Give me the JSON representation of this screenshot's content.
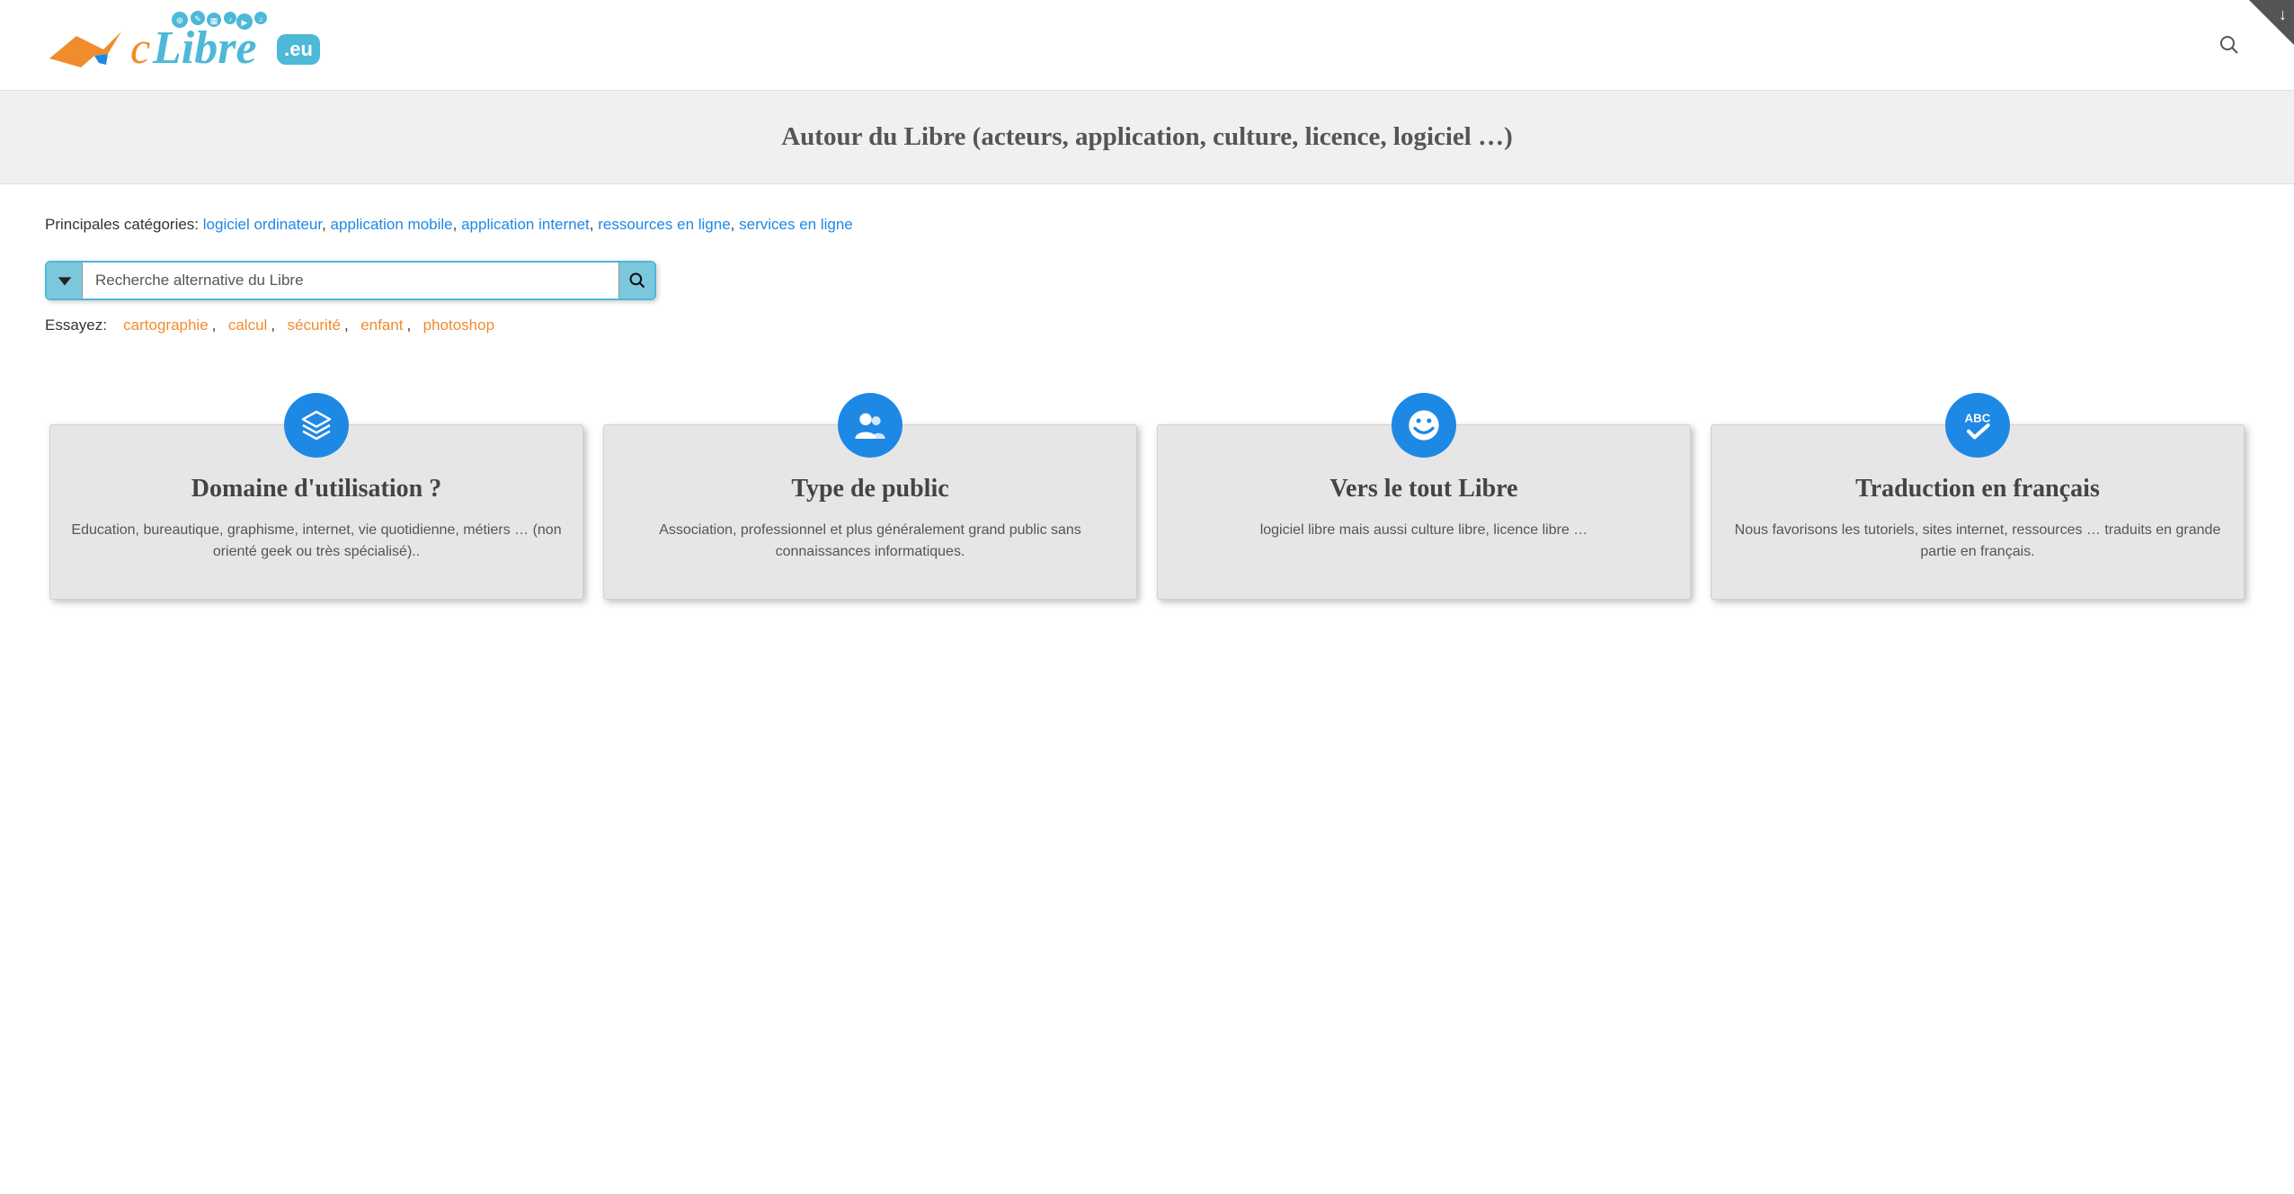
{
  "logo_text": "cLibre",
  "logo_badge": ".eu",
  "title": "Autour du Libre (acteurs, application, culture, licence, logiciel …)",
  "categories": {
    "label": "Principales catégories: ",
    "items": [
      "logiciel ordinateur",
      "application mobile",
      "application internet",
      "ressources en ligne",
      "services en ligne"
    ]
  },
  "search": {
    "placeholder": "Recherche alternative du Libre"
  },
  "try": {
    "label": "Essayez:",
    "items": [
      "cartographie",
      "calcul",
      "sécurité",
      "enfant",
      "photoshop"
    ]
  },
  "cards": [
    {
      "icon": "layers",
      "title": "Domaine d'utilisation ?",
      "text": "Education, bureautique, graphisme, internet, vie quotidienne, métiers …\n(non orienté geek ou très spécialisé).."
    },
    {
      "icon": "users",
      "title": "Type de public",
      "text": "Association, professionnel et plus généralement grand public\nsans connaissances informatiques."
    },
    {
      "icon": "smile",
      "title": "Vers le tout Libre",
      "text": "logiciel libre mais aussi culture libre, licence libre …"
    },
    {
      "icon": "abc",
      "title": "Traduction en français",
      "text": "Nous favorisons les tutoriels, sites internet, ressources … traduits en grande partie en français."
    }
  ]
}
